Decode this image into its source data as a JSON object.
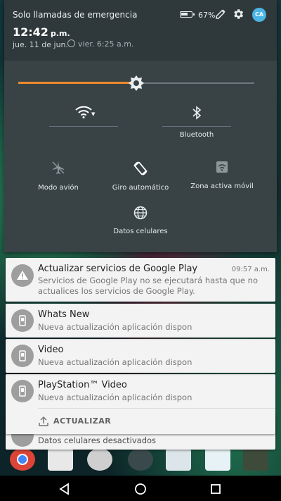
{
  "status_bar": {
    "carrier": "Solo llamadas de emergencia",
    "time": "12:42",
    "ampm": "p.m.",
    "date": "jue. 11 de jun.",
    "alarm": "vier. 6:25 a.m.",
    "battery_pct": "67%",
    "battery_level": 0.67,
    "avatar_initials": "CA"
  },
  "brightness": {
    "level": 0.5,
    "accent": "#ef8a2c"
  },
  "tiles": [
    {
      "label": "",
      "icon": "wifi-icon"
    },
    {
      "label": "Bluetooth",
      "icon": "bluetooth-icon"
    },
    {
      "label": "Modo avión",
      "icon": "airplane-icon"
    },
    {
      "label": "Giro automático",
      "icon": "rotate-icon"
    },
    {
      "label": "Zona activa móvil",
      "icon": "hotspot-icon"
    },
    {
      "label": "Datos celulares",
      "icon": "globe-icon"
    }
  ],
  "notifications": [
    {
      "title": "Actualizar servicios de Google Play",
      "time": "09:57 a.m.",
      "text": "Servicios de Google Play no se ejecutará hasta que no actualices los servicios de Google Play.",
      "icon": "warning-icon"
    },
    {
      "title": "Whats New",
      "text": "Nueva actualización aplicación dispon",
      "icon": "phone-icon"
    },
    {
      "title": "Video",
      "text": "Nueva actualización aplicación dispon",
      "icon": "phone-icon"
    },
    {
      "title": "PlayStation™ Video",
      "text": "Nueva actualización aplicación dispon",
      "icon": "phone-icon",
      "action": "ACTUALIZAR"
    },
    {
      "text": "Datos celulares desactivados",
      "icon": "data-off-icon"
    }
  ],
  "navigation": {
    "back": "back-icon",
    "home": "home-icon",
    "recents": "recents-icon"
  }
}
